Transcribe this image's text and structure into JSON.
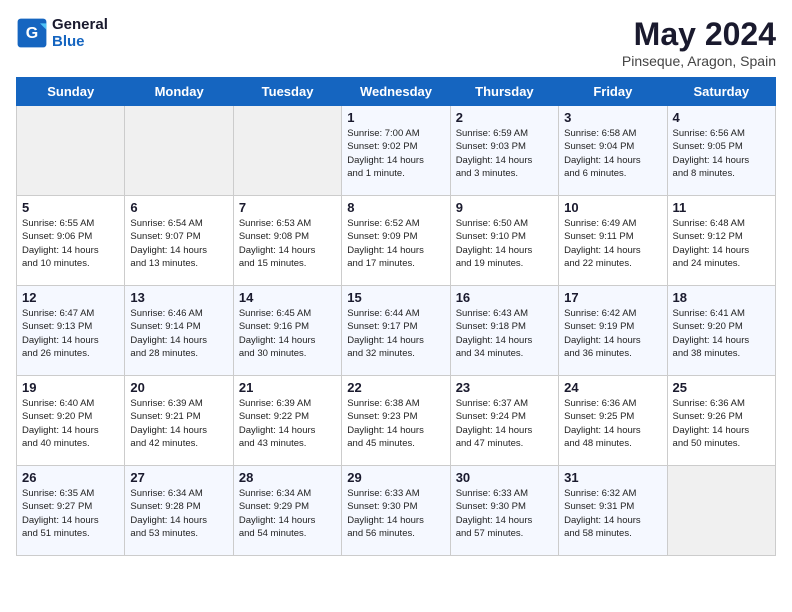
{
  "logo": {
    "line1": "General",
    "line2": "Blue"
  },
  "title": "May 2024",
  "location": "Pinseque, Aragon, Spain",
  "days_of_week": [
    "Sunday",
    "Monday",
    "Tuesday",
    "Wednesday",
    "Thursday",
    "Friday",
    "Saturday"
  ],
  "weeks": [
    [
      {
        "day": "",
        "info": ""
      },
      {
        "day": "",
        "info": ""
      },
      {
        "day": "",
        "info": ""
      },
      {
        "day": "1",
        "info": "Sunrise: 7:00 AM\nSunset: 9:02 PM\nDaylight: 14 hours\nand 1 minute."
      },
      {
        "day": "2",
        "info": "Sunrise: 6:59 AM\nSunset: 9:03 PM\nDaylight: 14 hours\nand 3 minutes."
      },
      {
        "day": "3",
        "info": "Sunrise: 6:58 AM\nSunset: 9:04 PM\nDaylight: 14 hours\nand 6 minutes."
      },
      {
        "day": "4",
        "info": "Sunrise: 6:56 AM\nSunset: 9:05 PM\nDaylight: 14 hours\nand 8 minutes."
      }
    ],
    [
      {
        "day": "5",
        "info": "Sunrise: 6:55 AM\nSunset: 9:06 PM\nDaylight: 14 hours\nand 10 minutes."
      },
      {
        "day": "6",
        "info": "Sunrise: 6:54 AM\nSunset: 9:07 PM\nDaylight: 14 hours\nand 13 minutes."
      },
      {
        "day": "7",
        "info": "Sunrise: 6:53 AM\nSunset: 9:08 PM\nDaylight: 14 hours\nand 15 minutes."
      },
      {
        "day": "8",
        "info": "Sunrise: 6:52 AM\nSunset: 9:09 PM\nDaylight: 14 hours\nand 17 minutes."
      },
      {
        "day": "9",
        "info": "Sunrise: 6:50 AM\nSunset: 9:10 PM\nDaylight: 14 hours\nand 19 minutes."
      },
      {
        "day": "10",
        "info": "Sunrise: 6:49 AM\nSunset: 9:11 PM\nDaylight: 14 hours\nand 22 minutes."
      },
      {
        "day": "11",
        "info": "Sunrise: 6:48 AM\nSunset: 9:12 PM\nDaylight: 14 hours\nand 24 minutes."
      }
    ],
    [
      {
        "day": "12",
        "info": "Sunrise: 6:47 AM\nSunset: 9:13 PM\nDaylight: 14 hours\nand 26 minutes."
      },
      {
        "day": "13",
        "info": "Sunrise: 6:46 AM\nSunset: 9:14 PM\nDaylight: 14 hours\nand 28 minutes."
      },
      {
        "day": "14",
        "info": "Sunrise: 6:45 AM\nSunset: 9:16 PM\nDaylight: 14 hours\nand 30 minutes."
      },
      {
        "day": "15",
        "info": "Sunrise: 6:44 AM\nSunset: 9:17 PM\nDaylight: 14 hours\nand 32 minutes."
      },
      {
        "day": "16",
        "info": "Sunrise: 6:43 AM\nSunset: 9:18 PM\nDaylight: 14 hours\nand 34 minutes."
      },
      {
        "day": "17",
        "info": "Sunrise: 6:42 AM\nSunset: 9:19 PM\nDaylight: 14 hours\nand 36 minutes."
      },
      {
        "day": "18",
        "info": "Sunrise: 6:41 AM\nSunset: 9:20 PM\nDaylight: 14 hours\nand 38 minutes."
      }
    ],
    [
      {
        "day": "19",
        "info": "Sunrise: 6:40 AM\nSunset: 9:20 PM\nDaylight: 14 hours\nand 40 minutes."
      },
      {
        "day": "20",
        "info": "Sunrise: 6:39 AM\nSunset: 9:21 PM\nDaylight: 14 hours\nand 42 minutes."
      },
      {
        "day": "21",
        "info": "Sunrise: 6:39 AM\nSunset: 9:22 PM\nDaylight: 14 hours\nand 43 minutes."
      },
      {
        "day": "22",
        "info": "Sunrise: 6:38 AM\nSunset: 9:23 PM\nDaylight: 14 hours\nand 45 minutes."
      },
      {
        "day": "23",
        "info": "Sunrise: 6:37 AM\nSunset: 9:24 PM\nDaylight: 14 hours\nand 47 minutes."
      },
      {
        "day": "24",
        "info": "Sunrise: 6:36 AM\nSunset: 9:25 PM\nDaylight: 14 hours\nand 48 minutes."
      },
      {
        "day": "25",
        "info": "Sunrise: 6:36 AM\nSunset: 9:26 PM\nDaylight: 14 hours\nand 50 minutes."
      }
    ],
    [
      {
        "day": "26",
        "info": "Sunrise: 6:35 AM\nSunset: 9:27 PM\nDaylight: 14 hours\nand 51 minutes."
      },
      {
        "day": "27",
        "info": "Sunrise: 6:34 AM\nSunset: 9:28 PM\nDaylight: 14 hours\nand 53 minutes."
      },
      {
        "day": "28",
        "info": "Sunrise: 6:34 AM\nSunset: 9:29 PM\nDaylight: 14 hours\nand 54 minutes."
      },
      {
        "day": "29",
        "info": "Sunrise: 6:33 AM\nSunset: 9:30 PM\nDaylight: 14 hours\nand 56 minutes."
      },
      {
        "day": "30",
        "info": "Sunrise: 6:33 AM\nSunset: 9:30 PM\nDaylight: 14 hours\nand 57 minutes."
      },
      {
        "day": "31",
        "info": "Sunrise: 6:32 AM\nSunset: 9:31 PM\nDaylight: 14 hours\nand 58 minutes."
      },
      {
        "day": "",
        "info": ""
      }
    ]
  ]
}
